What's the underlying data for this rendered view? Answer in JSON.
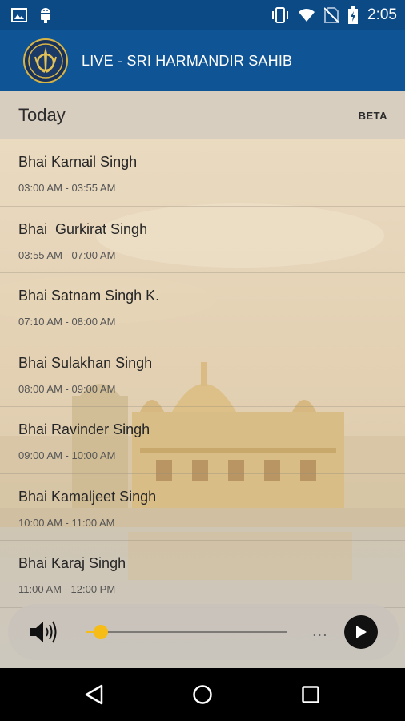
{
  "status_bar": {
    "time": "2:05",
    "icons": [
      "image-icon",
      "android-icon",
      "vibrate-icon",
      "wifi-icon",
      "no-sim-icon",
      "battery-charging-icon"
    ]
  },
  "app_bar": {
    "title": "LIVE - SRI HARMANDIR SAHIB",
    "logo_icon": "khanda-logo-icon"
  },
  "list": {
    "header_title": "Today",
    "beta_label": "BETA",
    "items": [
      {
        "name": "Bhai Karnail Singh",
        "time": "03:00 AM - 03:55 AM"
      },
      {
        "name": "Bhai  Gurkirat Singh",
        "time": "03:55 AM - 07:00 AM"
      },
      {
        "name": "Bhai Satnam Singh K.",
        "time": "07:10 AM - 08:00 AM"
      },
      {
        "name": "Bhai Sulakhan Singh",
        "time": "08:00 AM - 09:00 AM"
      },
      {
        "name": "Bhai Ravinder Singh",
        "time": "09:00 AM - 10:00 AM"
      },
      {
        "name": "Bhai Kamaljeet Singh",
        "time": "10:00 AM - 11:00 AM"
      },
      {
        "name": "Bhai Karaj Singh",
        "time": "11:00 AM - 12:00 PM"
      }
    ]
  },
  "player": {
    "volume_icon": "speaker-icon",
    "progress_fraction": 0.07,
    "more_label": "...",
    "play_icon": "play-icon",
    "accent_color": "#f6bd18"
  },
  "nav_bar": {
    "icons": [
      "back-icon",
      "home-icon",
      "recents-icon"
    ]
  },
  "colors": {
    "app_bar": "#0f5494",
    "status_bar": "#0c4a86"
  }
}
